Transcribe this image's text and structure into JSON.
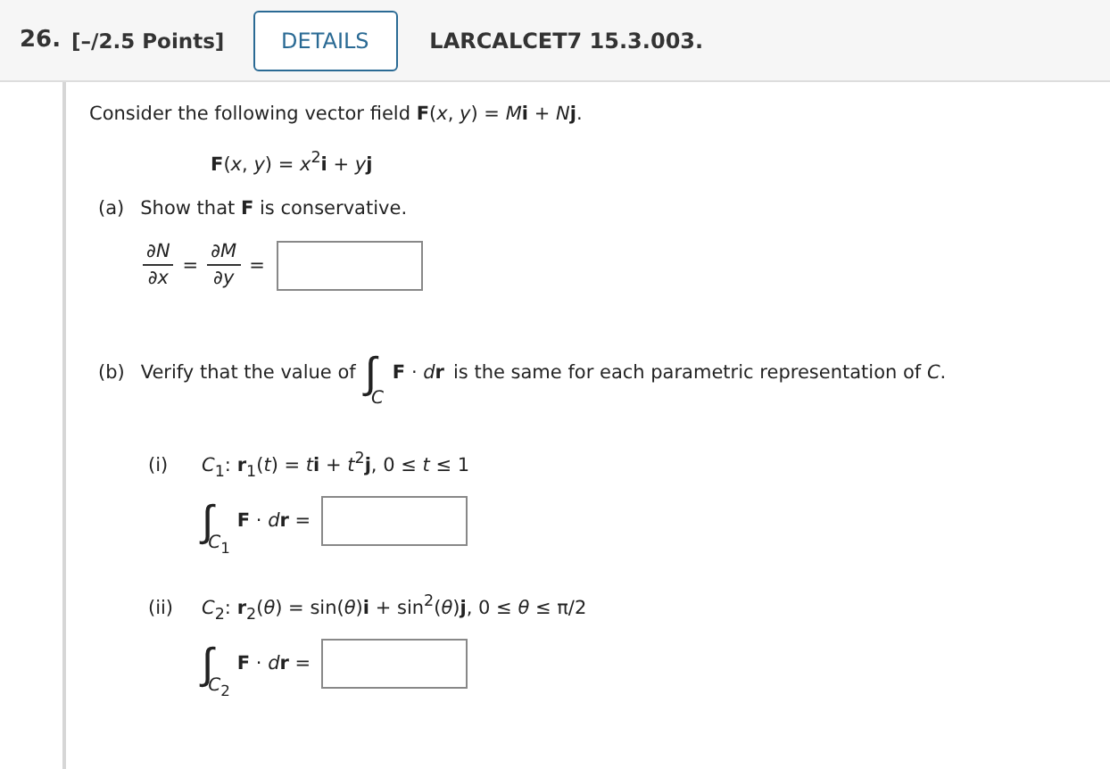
{
  "header": {
    "number": "26.",
    "points": "[–/2.5 Points]",
    "details_button": "DETAILS",
    "problem_code": "LARCALCET7 15.3.003."
  },
  "intro": "Consider the following vector field **F**(*x*, *y*) = *M*​**i** + *N*​**j**.",
  "field_definition": "**F**(*x*, *y*) = *x*$^{2}$**i** + *y*​**j**",
  "part_a": {
    "label": "(a)",
    "text": "Show that **F** is conservative.",
    "fractions": [
      {
        "numerator": "∂*N*",
        "denominator": "∂*x*",
        "sign": "="
      },
      {
        "numerator": "∂*M*",
        "denominator": "∂*y*",
        "sign": "="
      }
    ]
  },
  "part_b": {
    "label": "(b)",
    "text_before": "Verify that the value of",
    "integral_sign": "∫",
    "subscript": "*C*",
    "integrand": "**F** · *d*​**r**",
    "text_after": "is the same for each parametric representation of *C*.",
    "subparts": [
      {
        "label": "(i)",
        "curve": "*C*$_{1}$: **r**$_{1}$(*t*) = *t*​**i** + *t*$^{2}$**j**, 0 ≤ *t* ≤ 1",
        "integral_sign": "∫",
        "subscript": "*C*$_{1}$",
        "integrand": "**F** · *d*​**r** ="
      },
      {
        "label": "(ii)",
        "curve": "*C*$_{2}$: **r**$_{2}$(*θ*) = sin(*θ*)**i** + sin$^{2}$(*θ*)**j**, 0 ≤ *θ* ≤ π/2",
        "integral_sign": "∫",
        "subscript": "*C*$_{2}$",
        "integrand": "**F** · *d*​**r** ="
      }
    ]
  }
}
